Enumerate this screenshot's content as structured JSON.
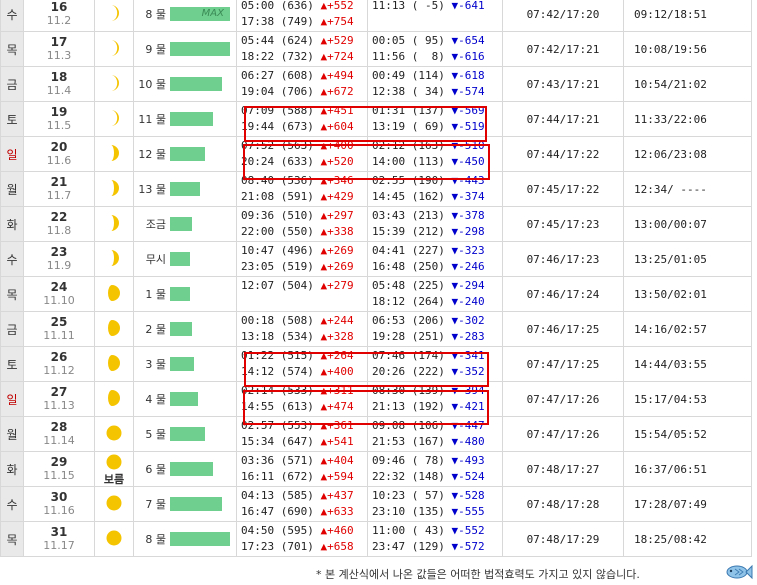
{
  "rows": [
    {
      "wd": "수",
      "sunday": false,
      "day": "16",
      "lunar": "11.2",
      "moon": "crescent",
      "moon_label": "",
      "mul": "8 물",
      "bar": 0.6,
      "max": "MAX",
      "h1": "05:00 (636)",
      "h1d": "▲+552",
      "h2": "17:38 (749)",
      "h2d": "▲+754",
      "l1": "11:13 ( -5)",
      "l1d": "▼-641",
      "l2": "",
      "l2d": "",
      "sun": "07:42/17:20",
      "moonrs": "09:12/18:51"
    },
    {
      "wd": "목",
      "sunday": false,
      "day": "17",
      "lunar": "11.3",
      "moon": "crescent",
      "moon_label": "",
      "mul": "9 물",
      "bar": 0.6,
      "max": "",
      "h1": "05:44 (624)",
      "h1d": "▲+529",
      "h2": "18:22 (732)",
      "h2d": "▲+724",
      "l1": "00:05 ( 95)",
      "l1d": "▼-654",
      "l2": "11:56 (  8)",
      "l2d": "▼-616",
      "sun": "07:42/17:21",
      "moonrs": "10:08/19:56"
    },
    {
      "wd": "금",
      "sunday": false,
      "day": "18",
      "lunar": "11.4",
      "moon": "crescent",
      "moon_label": "",
      "mul": "10 물",
      "bar": 0.52,
      "max": "",
      "h1": "06:27 (608)",
      "h1d": "▲+494",
      "h2": "19:04 (706)",
      "h2d": "▲+672",
      "l1": "00:49 (114)",
      "l1d": "▼-618",
      "l2": "12:38 ( 34)",
      "l2d": "▼-574",
      "sun": "07:43/17:21",
      "moonrs": "10:54/21:02"
    },
    {
      "wd": "토",
      "sunday": false,
      "day": "19",
      "lunar": "11.5",
      "moon": "crescent",
      "moon_label": "",
      "mul": "11 물",
      "bar": 0.43,
      "max": "",
      "h1": "07:09 (588)",
      "h1d": "▲+451",
      "h2": "19:44 (673)",
      "h2d": "▲+604",
      "l1": "01:31 (137)",
      "l1d": "▼-569",
      "l2": "13:19 ( 69)",
      "l2d": "▼-519",
      "sun": "07:44/17:21",
      "moonrs": "11:33/22:06"
    },
    {
      "wd": "일",
      "sunday": true,
      "day": "20",
      "lunar": "11.6",
      "moon": "half",
      "moon_label": "",
      "mul": "12 물",
      "bar": 0.35,
      "max": "",
      "h1": "07:52 (563)",
      "h1d": "▲+400",
      "h2": "20:24 (633)",
      "h2d": "▲+520",
      "l1": "02:12 (163)",
      "l1d": "▼-510",
      "l2": "14:00 (113)",
      "l2d": "▼-450",
      "sun": "07:44/17:22",
      "moonrs": "12:06/23:08"
    },
    {
      "wd": "월",
      "sunday": false,
      "day": "21",
      "lunar": "11.7",
      "moon": "half",
      "moon_label": "",
      "mul": "13 물",
      "bar": 0.3,
      "max": "",
      "h1": "08:40 (536)",
      "h1d": "▲+346",
      "h2": "21:08 (591)",
      "h2d": "▲+429",
      "l1": "02:55 (190)",
      "l1d": "▼-443",
      "l2": "14:45 (162)",
      "l2d": "▼-374",
      "sun": "07:45/17:22",
      "moonrs": "12:34/ ----"
    },
    {
      "wd": "화",
      "sunday": false,
      "day": "22",
      "lunar": "11.8",
      "moon": "half",
      "moon_label": "",
      "mul": "조금",
      "bar": 0.22,
      "max": "",
      "h1": "09:36 (510)",
      "h1d": "▲+297",
      "h2": "22:00 (550)",
      "h2d": "▲+338",
      "l1": "03:43 (213)",
      "l1d": "▼-378",
      "l2": "15:39 (212)",
      "l2d": "▼-298",
      "sun": "07:45/17:23",
      "moonrs": "13:00/00:07"
    },
    {
      "wd": "수",
      "sunday": false,
      "day": "23",
      "lunar": "11.9",
      "moon": "half",
      "moon_label": "",
      "mul": "무시",
      "bar": 0.2,
      "max": "",
      "h1": "10:47 (496)",
      "h1d": "▲+269",
      "h2": "23:05 (519)",
      "h2d": "▲+269",
      "l1": "04:41 (227)",
      "l1d": "▼-323",
      "l2": "16:48 (250)",
      "l2d": "▼-246",
      "sun": "07:46/17:23",
      "moonrs": "13:25/01:05"
    },
    {
      "wd": "목",
      "sunday": false,
      "day": "24",
      "lunar": "11.10",
      "moon": "gibbous",
      "moon_label": "",
      "mul": "1 물",
      "bar": 0.2,
      "max": "",
      "h1": "12:07 (504)",
      "h1d": "▲+279",
      "h2": "",
      "h2d": "",
      "l1": "05:48 (225)",
      "l1d": "▼-294",
      "l2": "18:12 (264)",
      "l2d": "▼-240",
      "sun": "07:46/17:24",
      "moonrs": "13:50/02:01"
    },
    {
      "wd": "금",
      "sunday": false,
      "day": "25",
      "lunar": "11.11",
      "moon": "gibbous",
      "moon_label": "",
      "mul": "2 물",
      "bar": 0.22,
      "max": "",
      "h1": "00:18 (508)",
      "h1d": "▲+244",
      "h2": "13:18 (534)",
      "h2d": "▲+328",
      "l1": "06:53 (206)",
      "l1d": "▼-302",
      "l2": "19:28 (251)",
      "l2d": "▼-283",
      "sun": "07:46/17:25",
      "moonrs": "14:16/02:57"
    },
    {
      "wd": "토",
      "sunday": false,
      "day": "26",
      "lunar": "11.12",
      "moon": "gibbous",
      "moon_label": "",
      "mul": "3 물",
      "bar": 0.24,
      "max": "",
      "h1": "01:22 (515)",
      "h1d": "▲+264",
      "h2": "14:12 (574)",
      "h2d": "▲+400",
      "l1": "07:46 (174)",
      "l1d": "▼-341",
      "l2": "20:26 (222)",
      "l2d": "▼-352",
      "sun": "07:47/17:25",
      "moonrs": "14:44/03:55"
    },
    {
      "wd": "일",
      "sunday": true,
      "day": "27",
      "lunar": "11.13",
      "moon": "gibbous",
      "moon_label": "",
      "mul": "4 물",
      "bar": 0.28,
      "max": "",
      "h1": "02:14 (533)",
      "h1d": "▲+311",
      "h2": "14:55 (613)",
      "h2d": "▲+474",
      "l1": "08:30 (139)",
      "l1d": "▼-394",
      "l2": "21:13 (192)",
      "l2d": "▼-421",
      "sun": "07:47/17:26",
      "moonrs": "15:17/04:53"
    },
    {
      "wd": "월",
      "sunday": false,
      "day": "28",
      "lunar": "11.14",
      "moon": "full",
      "moon_label": "",
      "mul": "5 물",
      "bar": 0.35,
      "max": "",
      "h1": "02:57 (553)",
      "h1d": "▲+361",
      "h2": "15:34 (647)",
      "h2d": "▲+541",
      "l1": "09:08 (106)",
      "l1d": "▼-447",
      "l2": "21:53 (167)",
      "l2d": "▼-480",
      "sun": "07:47/17:26",
      "moonrs": "15:54/05:52"
    },
    {
      "wd": "화",
      "sunday": false,
      "day": "29",
      "lunar": "11.15",
      "moon": "full",
      "moon_label": "보름",
      "mul": "6 물",
      "bar": 0.43,
      "max": "",
      "h1": "03:36 (571)",
      "h1d": "▲+404",
      "h2": "16:11 (672)",
      "h2d": "▲+594",
      "l1": "09:46 ( 78)",
      "l1d": "▼-493",
      "l2": "22:32 (148)",
      "l2d": "▼-524",
      "sun": "07:48/17:27",
      "moonrs": "16:37/06:51"
    },
    {
      "wd": "수",
      "sunday": false,
      "day": "30",
      "lunar": "11.16",
      "moon": "full",
      "moon_label": "",
      "mul": "7 물",
      "bar": 0.52,
      "max": "",
      "h1": "04:13 (585)",
      "h1d": "▲+437",
      "h2": "16:47 (690)",
      "h2d": "▲+633",
      "l1": "10:23 ( 57)",
      "l1d": "▼-528",
      "l2": "23:10 (135)",
      "l2d": "▼-555",
      "sun": "07:48/17:28",
      "moonrs": "17:28/07:49"
    },
    {
      "wd": "목",
      "sunday": false,
      "day": "31",
      "lunar": "11.17",
      "moon": "full",
      "moon_label": "",
      "mul": "8 물",
      "bar": 0.6,
      "max": "",
      "h1": "04:50 (595)",
      "h1d": "▲+460",
      "h2": "17:23 (701)",
      "h2d": "▲+658",
      "l1": "11:00 ( 43)",
      "l1d": "▼-552",
      "l2": "23:47 (129)",
      "l2d": "▼-572",
      "sun": "07:48/17:29",
      "moonrs": "18:25/08:42"
    }
  ],
  "footer": "* 본 계산식에서 나온 값들은 어떠한 법적효력도 가지고 있지 않습니다.",
  "icons": {
    "fish": "fish-icon",
    "moon": "moon-phase-icon"
  },
  "colors": {
    "bar": "#6fcf8f",
    "rise": "#e00000",
    "fall": "#0000cc",
    "highlight": "#e00000",
    "sunday": "#c00000"
  }
}
